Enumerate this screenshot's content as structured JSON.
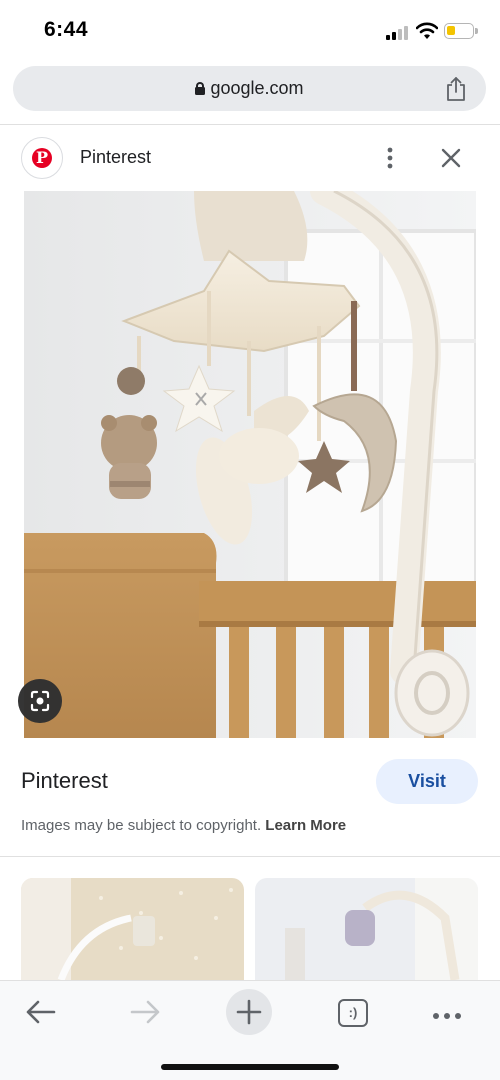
{
  "status_bar": {
    "time": "6:44",
    "signal_icon": "cellular-signal-icon",
    "wifi_icon": "wifi-icon",
    "battery_icon": "battery-icon",
    "battery_color": "#f4c400"
  },
  "browser": {
    "url": "google.com",
    "lock_icon": "lock-icon",
    "share_icon": "share-icon"
  },
  "source": {
    "name": "Pinterest",
    "logo_letter": "P",
    "brand_color": "#e60023",
    "more_icon": "more-vert-icon",
    "close_icon": "close-icon"
  },
  "result": {
    "title": "Pinterest",
    "visit_label": "Visit",
    "copyright_text": "Images may be subject to copyright.",
    "learn_more_label": "Learn More",
    "lens_icon": "google-lens-icon"
  },
  "toolbar": {
    "back_icon": "back-arrow-icon",
    "forward_icon": "forward-arrow-icon",
    "new_tab_icon": "plus-icon",
    "tab_switcher_label": ":)",
    "menu_icon": "more-horiz-icon"
  }
}
